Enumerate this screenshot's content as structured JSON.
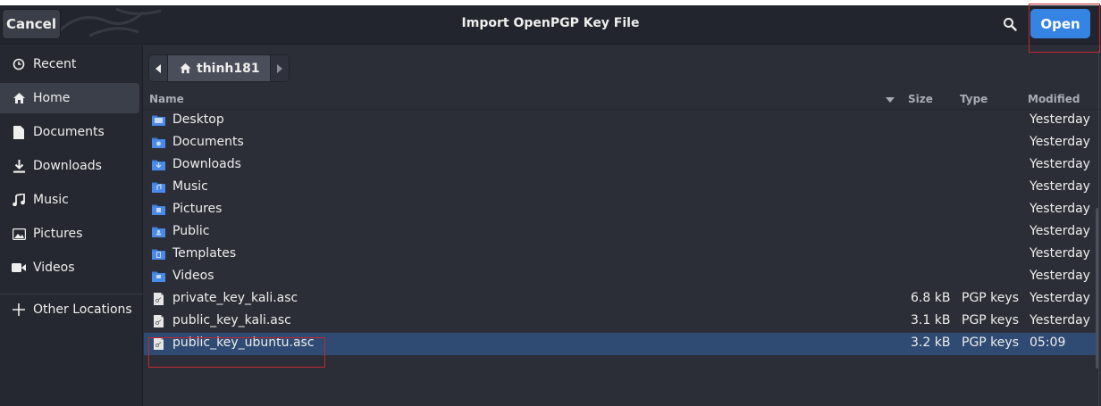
{
  "header": {
    "cancel_label": "Cancel",
    "title": "Import OpenPGP Key File",
    "open_label": "Open"
  },
  "sidebar": {
    "items": [
      {
        "label": "Recent",
        "icon": "clock-icon"
      },
      {
        "label": "Home",
        "icon": "home-icon"
      },
      {
        "label": "Documents",
        "icon": "document-icon"
      },
      {
        "label": "Downloads",
        "icon": "download-icon"
      },
      {
        "label": "Music",
        "icon": "music-icon"
      },
      {
        "label": "Pictures",
        "icon": "picture-icon"
      },
      {
        "label": "Videos",
        "icon": "video-icon"
      },
      {
        "label": "Other Locations",
        "icon": "plus-icon"
      }
    ]
  },
  "pathbar": {
    "current": "thinh181"
  },
  "columns": {
    "name": "Name",
    "size": "Size",
    "type": "Type",
    "modified": "Modified"
  },
  "files": [
    {
      "name": "Desktop",
      "size": "",
      "type": "",
      "modified": "Yesterday",
      "kind": "folder"
    },
    {
      "name": "Documents",
      "size": "",
      "type": "",
      "modified": "Yesterday",
      "kind": "folder"
    },
    {
      "name": "Downloads",
      "size": "",
      "type": "",
      "modified": "Yesterday",
      "kind": "folder"
    },
    {
      "name": "Music",
      "size": "",
      "type": "",
      "modified": "Yesterday",
      "kind": "folder"
    },
    {
      "name": "Pictures",
      "size": "",
      "type": "",
      "modified": "Yesterday",
      "kind": "folder"
    },
    {
      "name": "Public",
      "size": "",
      "type": "",
      "modified": "Yesterday",
      "kind": "folder"
    },
    {
      "name": "Templates",
      "size": "",
      "type": "",
      "modified": "Yesterday",
      "kind": "folder"
    },
    {
      "name": "Videos",
      "size": "",
      "type": "",
      "modified": "Yesterday",
      "kind": "folder"
    },
    {
      "name": "private_key_kali.asc",
      "size": "6.8 kB",
      "type": "PGP keys",
      "modified": "Yesterday",
      "kind": "file"
    },
    {
      "name": "public_key_kali.asc",
      "size": "3.1 kB",
      "type": "PGP keys",
      "modified": "Yesterday",
      "kind": "file"
    },
    {
      "name": "public_key_ubuntu.asc",
      "size": "3.2 kB",
      "type": "PGP keys",
      "modified": "05:09",
      "kind": "file"
    }
  ],
  "colors": {
    "accent": "#3584e4",
    "selection": "#2f4a73",
    "highlight_box": "#c0282c",
    "folder_blue": "#3b7ddd"
  }
}
